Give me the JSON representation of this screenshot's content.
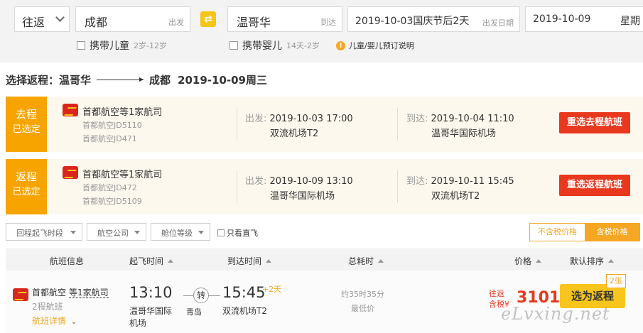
{
  "search": {
    "trip_type": "往返",
    "from_city": "成都",
    "from_hint": "出发",
    "to_city": "温哥华",
    "to_hint": "到达",
    "depart_date": "2019-10-03国庆节后2天",
    "depart_hint": "出发日期",
    "return_date": "2019-10-09",
    "return_weekday": "星期",
    "child_label": "携带儿童",
    "child_age": "2岁-12岁",
    "infant_label": "携带婴儿",
    "infant_age": "14天-2岁",
    "booking_note": "儿童/婴儿预订说明",
    "info_glyph": "!",
    "swap_glyph": "⇄"
  },
  "route_title": {
    "prefix": "选择返程：",
    "from": "温哥华",
    "to": "成都",
    "date": "2019-10-09周三"
  },
  "segments": [
    {
      "tag": "去程",
      "state": "已选定",
      "airline": "首都航空等1家航司",
      "flights": [
        "首都航空JD5110",
        "首都航空JD471"
      ],
      "depart_label": "出发: ",
      "depart_time": "2019-10-03 17:00",
      "depart_airport": "双流机场T2",
      "arrive_label": "到达: ",
      "arrive_time": "2019-10-04 11:10",
      "arrive_airport": "温哥华国际机场",
      "reselect": "重选去程航班"
    },
    {
      "tag": "返程",
      "state": "已选定",
      "airline": "首都航空等1家航司",
      "flights": [
        "首都航空JD472",
        "首都航空JD5109"
      ],
      "depart_label": "出发: ",
      "depart_time": "2019-10-09 13:10",
      "depart_airport": "温哥华国际机场",
      "arrive_label": "到达: ",
      "arrive_time": "2019-10-11 15:45",
      "arrive_airport": "双流机场T2",
      "reselect": "重选返程航班"
    }
  ],
  "filters": {
    "dropdowns": [
      "回程起飞时段",
      "航空公司",
      "舱位等级"
    ],
    "direct_only": "只看直飞",
    "price_tabs": [
      "不含税价格",
      "含税价格"
    ],
    "active_price_tab": 1
  },
  "table_header": {
    "flight_info": "航班信息",
    "depart_time": "起飞时间",
    "arrive_time": "到达时间",
    "duration": "总耗时",
    "price": "价格",
    "sort": "默认排序"
  },
  "result": {
    "airline": "首都航空",
    "airline_more": "等1家航司",
    "legs": "2程航班",
    "details": "航班详情",
    "depart_time": "13:10",
    "depart_airport_line1": "温哥华国际",
    "depart_airport_line2": "机场",
    "stop_glyph": "转",
    "stop_city": "青岛",
    "arrive_time": "15:45",
    "arrive_plus": "+2天",
    "arrive_airport": "双流机场T2",
    "duration": "约35时35分",
    "lowest": "最低价",
    "round_trip": "往返",
    "tax_incl": "含税¥",
    "price": "3101",
    "select_button": "选为返程",
    "seats": "2张"
  },
  "watermark": "eLvxing.net",
  "colors": {
    "accent_orange": "#f7a400",
    "reselect_red": "#e8381d",
    "select_yellow": "#f7c51c",
    "price_red": "#e8381d"
  }
}
